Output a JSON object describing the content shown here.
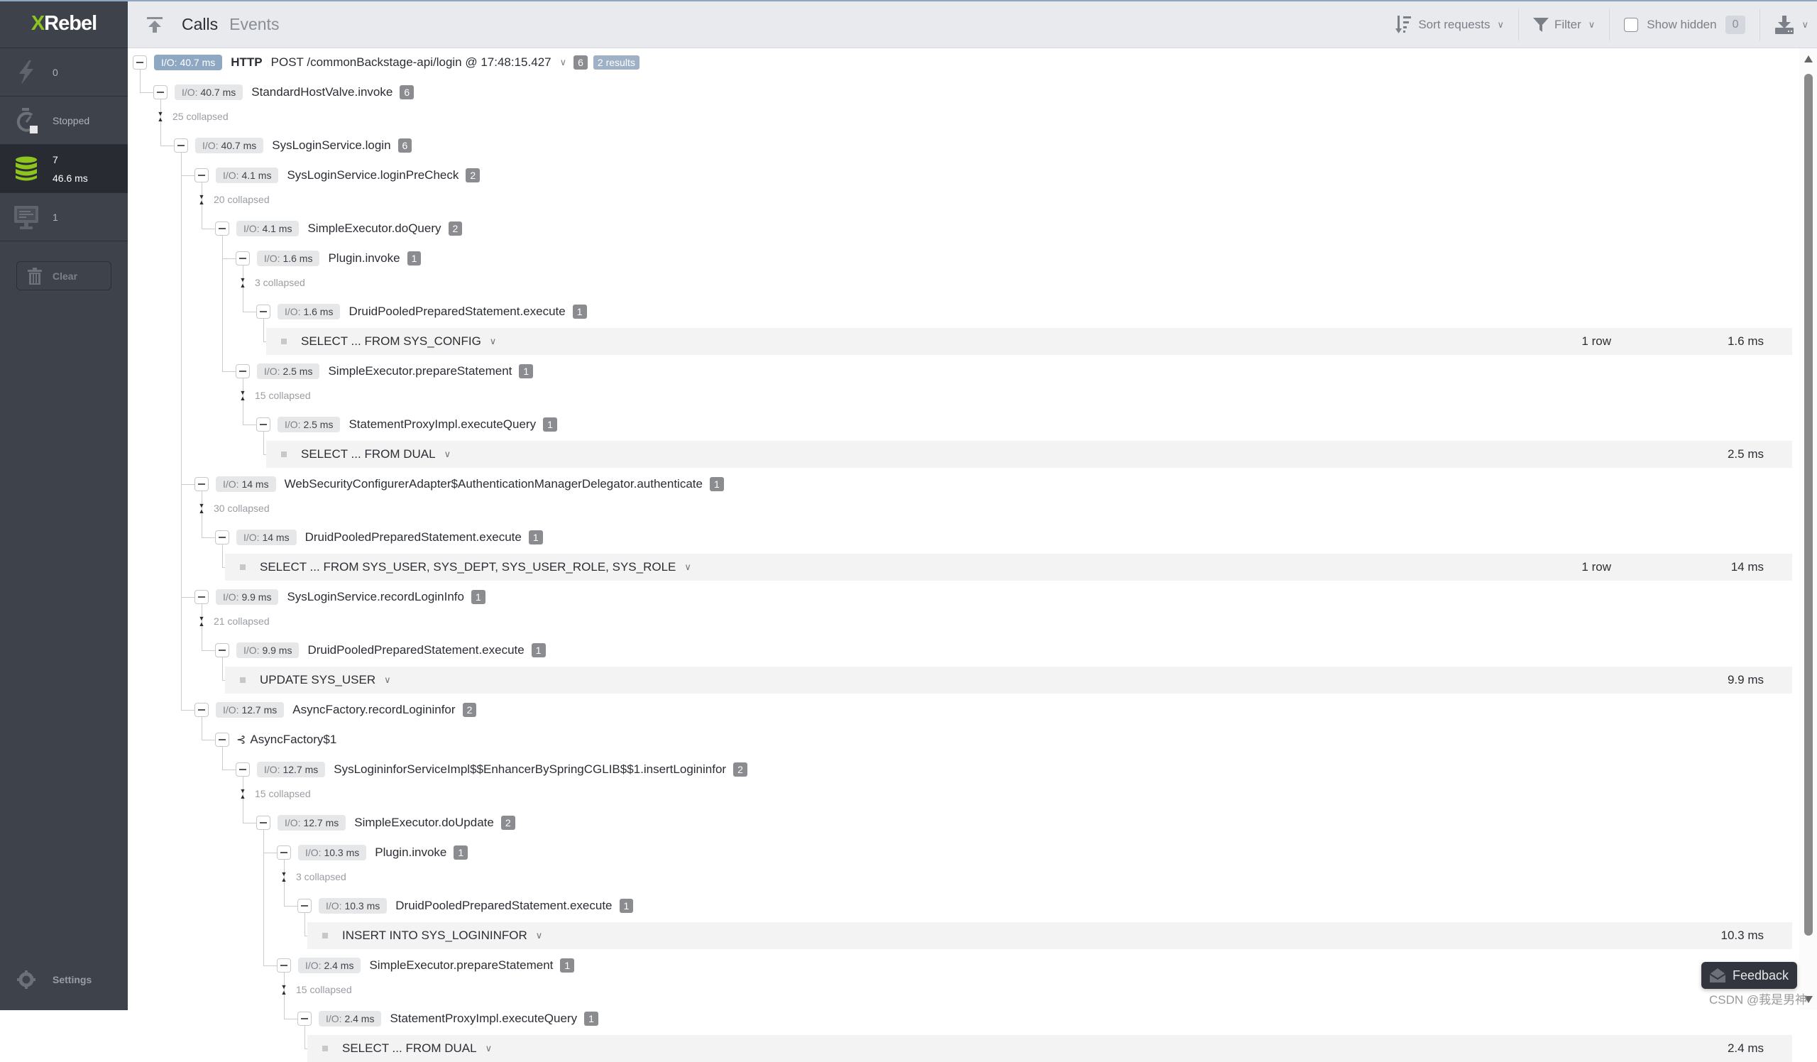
{
  "app": {
    "logo_x": "X",
    "logo_rest": "Rebel"
  },
  "sidebar": {
    "items": [
      {
        "name": "exceptions",
        "icon": "lightning-icon",
        "line1": "0"
      },
      {
        "name": "profiler",
        "icon": "stopwatch-icon",
        "line1": "Stopped"
      },
      {
        "name": "database",
        "icon": "database-icon",
        "line1": "7",
        "line2": "46.6 ms",
        "active": true
      },
      {
        "name": "io",
        "icon": "monitor-icon",
        "line1": "1"
      }
    ],
    "clear_label": "Clear",
    "settings_label": "Settings"
  },
  "header": {
    "tabs": [
      {
        "label": "Calls",
        "active": true
      },
      {
        "label": "Events",
        "active": false
      }
    ],
    "sort_label": "Sort requests",
    "filter_label": "Filter",
    "show_hidden_label": "Show hidden",
    "hidden_count": "0"
  },
  "colors": {
    "accent_green": "#8fc31f",
    "sidebar_bg": "#3e424b",
    "io_primary": "#8ea8c4"
  },
  "tree": {
    "root": {
      "io_label": "I/O:",
      "io_value": "40.7 ms",
      "protocol": "HTTP",
      "request": "POST /commonBackstage-api/login @ 17:48:15.427",
      "count": "6",
      "results": "2 results"
    },
    "nodes": [
      {
        "type": "call",
        "level": 1,
        "io": "40.7 ms",
        "name": "StandardHostValve.invoke",
        "count": "6"
      },
      {
        "type": "collapsed",
        "level": 1,
        "text": "25 collapsed"
      },
      {
        "type": "call",
        "level": 2,
        "io": "40.7 ms",
        "name": "SysLoginService.login",
        "count": "6"
      },
      {
        "type": "call",
        "level": 3,
        "io": "4.1 ms",
        "name": "SysLoginService.loginPreCheck",
        "count": "2"
      },
      {
        "type": "collapsed",
        "level": 3,
        "text": "20 collapsed"
      },
      {
        "type": "call",
        "level": 4,
        "io": "4.1 ms",
        "name": "SimpleExecutor.doQuery",
        "count": "2"
      },
      {
        "type": "call",
        "level": 5,
        "io": "1.6 ms",
        "name": "Plugin.invoke",
        "count": "1"
      },
      {
        "type": "collapsed",
        "level": 5,
        "text": "3 collapsed"
      },
      {
        "type": "call",
        "level": 6,
        "io": "1.6 ms",
        "name": "DruidPooledPreparedStatement.execute",
        "count": "1"
      },
      {
        "type": "sql",
        "level": 7,
        "query": "SELECT ... FROM SYS_CONFIG",
        "rows": "1 row",
        "time": "1.6 ms"
      },
      {
        "type": "call",
        "level": 5,
        "io": "2.5 ms",
        "name": "SimpleExecutor.prepareStatement",
        "count": "1"
      },
      {
        "type": "collapsed",
        "level": 5,
        "text": "15 collapsed"
      },
      {
        "type": "call",
        "level": 6,
        "io": "2.5 ms",
        "name": "StatementProxyImpl.executeQuery",
        "count": "1"
      },
      {
        "type": "sql",
        "level": 7,
        "query": "SELECT ... FROM DUAL",
        "rows": "",
        "time": "2.5 ms"
      },
      {
        "type": "call",
        "level": 3,
        "io": "14 ms",
        "name": "WebSecurityConfigurerAdapter$AuthenticationManagerDelegator.authenticate",
        "count": "1"
      },
      {
        "type": "collapsed",
        "level": 3,
        "text": "30 collapsed"
      },
      {
        "type": "call",
        "level": 4,
        "io": "14 ms",
        "name": "DruidPooledPreparedStatement.execute",
        "count": "1"
      },
      {
        "type": "sql",
        "level": 5,
        "query": "SELECT ... FROM SYS_USER, SYS_DEPT, SYS_USER_ROLE, SYS_ROLE",
        "rows": "1 row",
        "time": "14 ms"
      },
      {
        "type": "call",
        "level": 3,
        "io": "9.9 ms",
        "name": "SysLoginService.recordLoginInfo",
        "count": "1"
      },
      {
        "type": "collapsed",
        "level": 3,
        "text": "21 collapsed"
      },
      {
        "type": "call",
        "level": 4,
        "io": "9.9 ms",
        "name": "DruidPooledPreparedStatement.execute",
        "count": "1"
      },
      {
        "type": "sql",
        "level": 5,
        "query": "UPDATE SYS_USER",
        "rows": "",
        "time": "9.9 ms"
      },
      {
        "type": "call",
        "level": 3,
        "io": "12.7 ms",
        "name": "AsyncFactory.recordLogininfor",
        "count": "2"
      },
      {
        "type": "async",
        "level": 4,
        "name": "AsyncFactory$1"
      },
      {
        "type": "call",
        "level": 5,
        "io": "12.7 ms",
        "name": "SysLogininforServiceImpl$$EnhancerBySpringCGLIB$$1.insertLogininfor",
        "count": "2"
      },
      {
        "type": "collapsed",
        "level": 5,
        "text": "15 collapsed"
      },
      {
        "type": "call",
        "level": 6,
        "io": "12.7 ms",
        "name": "SimpleExecutor.doUpdate",
        "count": "2"
      },
      {
        "type": "call",
        "level": 7,
        "io": "10.3 ms",
        "name": "Plugin.invoke",
        "count": "1"
      },
      {
        "type": "collapsed",
        "level": 7,
        "text": "3 collapsed"
      },
      {
        "type": "call",
        "level": 8,
        "io": "10.3 ms",
        "name": "DruidPooledPreparedStatement.execute",
        "count": "1"
      },
      {
        "type": "sql",
        "level": 9,
        "query": "INSERT INTO SYS_LOGININFOR",
        "rows": "",
        "time": "10.3 ms"
      },
      {
        "type": "call",
        "level": 7,
        "io": "2.4 ms",
        "name": "SimpleExecutor.prepareStatement",
        "count": "1"
      },
      {
        "type": "collapsed",
        "level": 7,
        "text": "15 collapsed"
      },
      {
        "type": "call",
        "level": 8,
        "io": "2.4 ms",
        "name": "StatementProxyImpl.executeQuery",
        "count": "1"
      },
      {
        "type": "sql",
        "level": 9,
        "query": "SELECT ... FROM DUAL",
        "rows": "",
        "time": "2.4 ms"
      }
    ]
  },
  "feedback_label": "Feedback",
  "watermark": "CSDN @莪是男神"
}
